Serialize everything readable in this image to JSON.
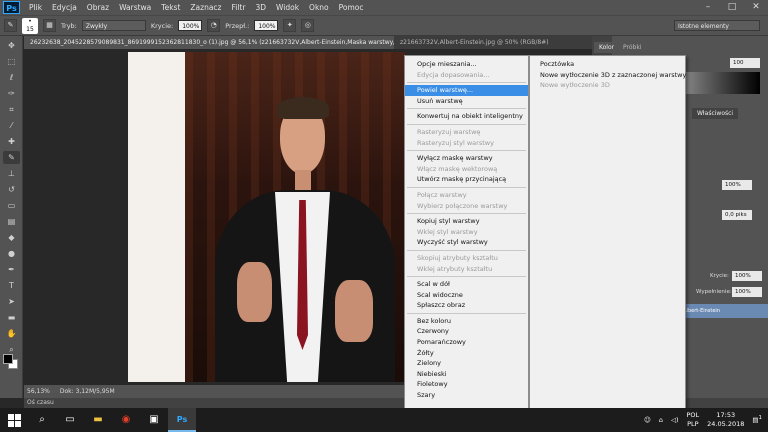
{
  "menubar": {
    "logo": "Ps",
    "items": [
      "Plik",
      "Edycja",
      "Obraz",
      "Warstwa",
      "Tekst",
      "Zaznacz",
      "Filtr",
      "3D",
      "Widok",
      "Okno",
      "Pomoc"
    ]
  },
  "options": {
    "brush_size": "15",
    "mode_label": "Tryb:",
    "mode_value": "Zwykły",
    "opacity_label": "Krycie:",
    "opacity_value": "100%",
    "flow_label": "Przepł.:",
    "flow_value": "100%",
    "workspace": "Istotne elementy"
  },
  "doc_tabs": [
    "26232638_2045228579089831_8691999152362811830_o (1).jpg @ 56,1% (z21663732V,Albert-Einstein,Maska warstwy/8) *",
    "z21663732V,Albert-Einstein.jpg @ 50% (RGB/8#)"
  ],
  "status": {
    "zoom": "56,13%",
    "doc": "Dok: 3,12M/5,95M",
    "timeline": "Oś czasu"
  },
  "panels": {
    "color_tab": "Kolor",
    "swatches_tab": "Próbki",
    "color_value": "100",
    "props_tab": "Właściwości",
    "density_value": "100%",
    "feather_value": "0,0 piks",
    "opacity_label": "Krycie:",
    "opacity_value": "100%",
    "fill_label": "Wypełnienie:",
    "fill_value": "100%",
    "layer_name": "2V,Albert-Einstein"
  },
  "context_menu": [
    {
      "label": "Opcje mieszania...",
      "state": "normal"
    },
    {
      "label": "Edycja dopasowania...",
      "state": "disabled"
    },
    {
      "sep": true
    },
    {
      "label": "Powiel warstwę...",
      "state": "selected"
    },
    {
      "label": "Usuń warstwę",
      "state": "normal"
    },
    {
      "sep": true
    },
    {
      "label": "Konwertuj na obiekt inteligentny",
      "state": "normal"
    },
    {
      "sep": true
    },
    {
      "label": "Rasteryzuj warstwę",
      "state": "disabled"
    },
    {
      "label": "Rasteryzuj styl warstwy",
      "state": "disabled"
    },
    {
      "sep": true
    },
    {
      "label": "Wyłącz maskę warstwy",
      "state": "normal"
    },
    {
      "label": "Włącz maskę wektorową",
      "state": "disabled"
    },
    {
      "label": "Utwórz maskę przycinającą",
      "state": "normal"
    },
    {
      "sep": true
    },
    {
      "label": "Połącz warstwy",
      "state": "disabled"
    },
    {
      "label": "Wybierz połączone warstwy",
      "state": "disabled"
    },
    {
      "sep": true
    },
    {
      "label": "Kopiuj styl warstwy",
      "state": "normal"
    },
    {
      "label": "Wklej styl warstwy",
      "state": "disabled"
    },
    {
      "label": "Wyczyść styl warstwy",
      "state": "normal"
    },
    {
      "sep": true
    },
    {
      "label": "Skopiuj atrybuty kształtu",
      "state": "disabled"
    },
    {
      "label": "Wklej atrybuty kształtu",
      "state": "disabled"
    },
    {
      "sep": true
    },
    {
      "label": "Scal w dół",
      "state": "normal"
    },
    {
      "label": "Scal widoczne",
      "state": "normal"
    },
    {
      "label": "Spłaszcz obraz",
      "state": "normal"
    },
    {
      "sep": true
    },
    {
      "label": "Bez koloru",
      "state": "normal"
    },
    {
      "label": "Czerwony",
      "state": "normal"
    },
    {
      "label": "Pomarańczowy",
      "state": "normal"
    },
    {
      "label": "Żółty",
      "state": "normal"
    },
    {
      "label": "Zielony",
      "state": "normal"
    },
    {
      "label": "Niebieski",
      "state": "normal"
    },
    {
      "label": "Fioletowy",
      "state": "normal"
    },
    {
      "label": "Szary",
      "state": "normal"
    }
  ],
  "submenu": [
    {
      "label": "Pocztówka",
      "state": "normal"
    },
    {
      "label": "Nowe wytłoczenie 3D z zaznaczonej warstwy",
      "state": "normal"
    },
    {
      "label": "Nowe wytłoczenie 3D",
      "state": "disabled"
    }
  ],
  "taskbar": {
    "lang_top": "POL",
    "lang_bottom": "PLP",
    "time": "17:53",
    "date": "24.05.2018",
    "notification_count": "1"
  },
  "icons": {
    "search": "search-icon",
    "taskview": "task-view-icon",
    "chrome": "chrome-icon",
    "store": "store-icon",
    "photoshop": "photoshop-icon"
  }
}
